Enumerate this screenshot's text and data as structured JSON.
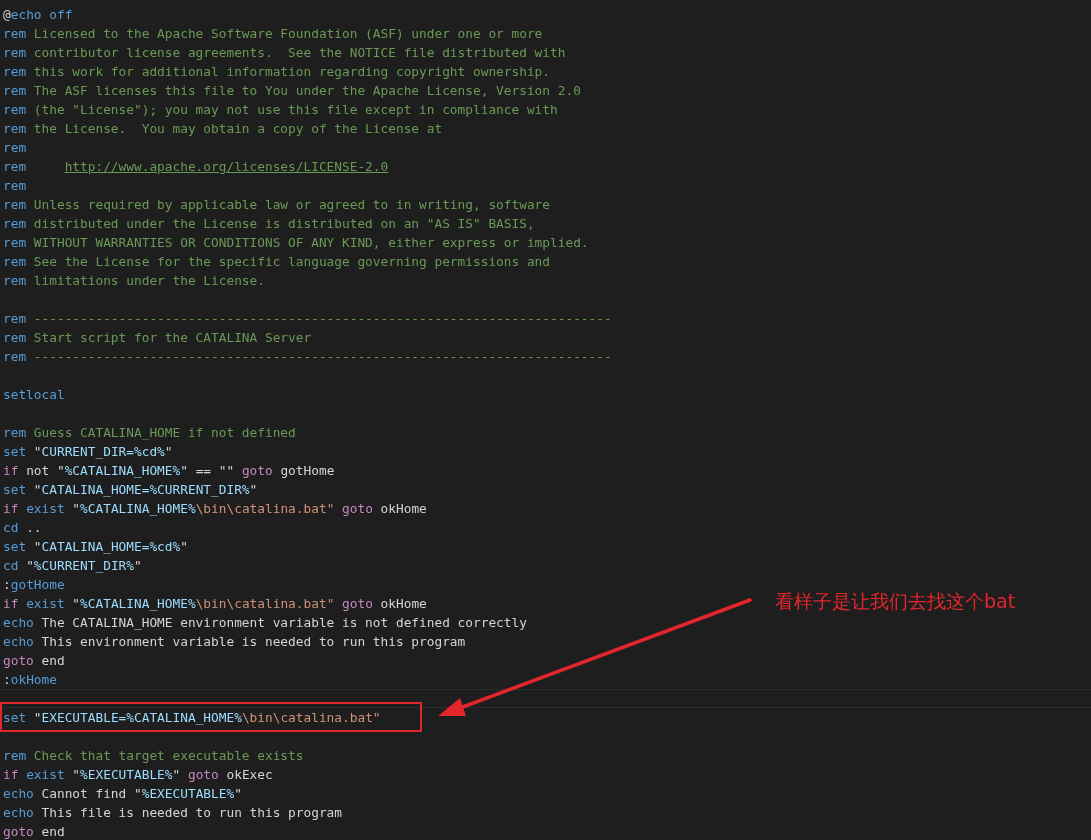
{
  "editor": {
    "lines": [
      {
        "current": false,
        "tokens": [
          {
            "kind": "plain",
            "text": "@"
          },
          {
            "kind": "kw",
            "text": "echo off"
          }
        ]
      },
      {
        "current": false,
        "tokens": [
          {
            "kind": "kw",
            "text": "rem"
          },
          {
            "kind": "comment",
            "text": " Licensed to the Apache Software Foundation (ASF) under one or more"
          }
        ]
      },
      {
        "current": false,
        "tokens": [
          {
            "kind": "kw",
            "text": "rem"
          },
          {
            "kind": "comment",
            "text": " contributor license agreements.  See the NOTICE file distributed with"
          }
        ]
      },
      {
        "current": false,
        "tokens": [
          {
            "kind": "kw",
            "text": "rem"
          },
          {
            "kind": "comment",
            "text": " this work for additional information regarding copyright ownership."
          }
        ]
      },
      {
        "current": false,
        "tokens": [
          {
            "kind": "kw",
            "text": "rem"
          },
          {
            "kind": "comment",
            "text": " The ASF licenses this file to You under the Apache License, Version 2.0"
          }
        ]
      },
      {
        "current": false,
        "tokens": [
          {
            "kind": "kw",
            "text": "rem"
          },
          {
            "kind": "comment",
            "text": " (the \"License\"); you may not use this file except in compliance with"
          }
        ]
      },
      {
        "current": false,
        "tokens": [
          {
            "kind": "kw",
            "text": "rem"
          },
          {
            "kind": "comment",
            "text": " the License.  You may obtain a copy of the License at"
          }
        ]
      },
      {
        "current": false,
        "tokens": [
          {
            "kind": "kw",
            "text": "rem"
          }
        ]
      },
      {
        "current": false,
        "tokens": [
          {
            "kind": "kw",
            "text": "rem     "
          },
          {
            "kind": "link",
            "text": "http://www.apache.org/licenses/LICENSE-2.0"
          }
        ]
      },
      {
        "current": false,
        "tokens": [
          {
            "kind": "kw",
            "text": "rem"
          }
        ]
      },
      {
        "current": false,
        "tokens": [
          {
            "kind": "kw",
            "text": "rem"
          },
          {
            "kind": "comment",
            "text": " Unless required by applicable law or agreed to in writing, software"
          }
        ]
      },
      {
        "current": false,
        "tokens": [
          {
            "kind": "kw",
            "text": "rem"
          },
          {
            "kind": "comment",
            "text": " distributed under the License is distributed on an \"AS IS\" BASIS,"
          }
        ]
      },
      {
        "current": false,
        "tokens": [
          {
            "kind": "kw",
            "text": "rem"
          },
          {
            "kind": "comment",
            "text": " WITHOUT WARRANTIES OR CONDITIONS OF ANY KIND, either express or implied."
          }
        ]
      },
      {
        "current": false,
        "tokens": [
          {
            "kind": "kw",
            "text": "rem"
          },
          {
            "kind": "comment",
            "text": " See the License for the specific language governing permissions and"
          }
        ]
      },
      {
        "current": false,
        "tokens": [
          {
            "kind": "kw",
            "text": "rem"
          },
          {
            "kind": "comment",
            "text": " limitations under the License."
          }
        ]
      },
      {
        "current": false
      },
      {
        "current": false,
        "tokens": [
          {
            "kind": "kw",
            "text": "rem"
          },
          {
            "kind": "comment",
            "text": " ---------------------------------------------------------------------------"
          }
        ]
      },
      {
        "current": false,
        "tokens": [
          {
            "kind": "kw",
            "text": "rem"
          },
          {
            "kind": "comment",
            "text": " Start script for the CATALINA Server"
          }
        ]
      },
      {
        "current": false,
        "tokens": [
          {
            "kind": "kw",
            "text": "rem"
          },
          {
            "kind": "comment",
            "text": " ---------------------------------------------------------------------------"
          }
        ]
      },
      {
        "current": false
      },
      {
        "current": false,
        "tokens": [
          {
            "kind": "kw",
            "text": "setlocal"
          }
        ]
      },
      {
        "current": false
      },
      {
        "current": false,
        "tokens": [
          {
            "kind": "kw",
            "text": "rem"
          },
          {
            "kind": "comment",
            "text": " Guess CATALINA_HOME if not defined"
          }
        ]
      },
      {
        "current": false,
        "tokens": [
          {
            "kind": "kw",
            "text": "set"
          },
          {
            "kind": "plain",
            "text": " \""
          },
          {
            "kind": "var",
            "text": "CURRENT_DIR=%cd%"
          },
          {
            "kind": "plain",
            "text": "\""
          }
        ]
      },
      {
        "current": false,
        "tokens": [
          {
            "kind": "ctrl",
            "text": "if"
          },
          {
            "kind": "plain",
            "text": " not \""
          },
          {
            "kind": "var",
            "text": "%CATALINA_HOME%"
          },
          {
            "kind": "plain",
            "text": "\" == \"\" "
          },
          {
            "kind": "ctrl",
            "text": "goto"
          },
          {
            "kind": "plain",
            "text": " gotHome"
          }
        ]
      },
      {
        "current": false,
        "tokens": [
          {
            "kind": "kw",
            "text": "set"
          },
          {
            "kind": "plain",
            "text": " \""
          },
          {
            "kind": "var",
            "text": "CATALINA_HOME=%CURRENT_DIR%"
          },
          {
            "kind": "plain",
            "text": "\""
          }
        ]
      },
      {
        "current": false,
        "tokens": [
          {
            "kind": "ctrl",
            "text": "if"
          },
          {
            "kind": "kw",
            "text": " exist"
          },
          {
            "kind": "plain",
            "text": " \""
          },
          {
            "kind": "var",
            "text": "%CATALINA_HOME%"
          },
          {
            "kind": "str",
            "text": "\\bin\\catalina.bat\""
          },
          {
            "kind": "ctrl",
            "text": " goto"
          },
          {
            "kind": "plain",
            "text": " okHome"
          }
        ]
      },
      {
        "current": false,
        "tokens": [
          {
            "kind": "kw",
            "text": "cd"
          },
          {
            "kind": "plain",
            "text": " .."
          }
        ]
      },
      {
        "current": false,
        "tokens": [
          {
            "kind": "kw",
            "text": "set"
          },
          {
            "kind": "plain",
            "text": " \""
          },
          {
            "kind": "var",
            "text": "CATALINA_HOME=%cd%"
          },
          {
            "kind": "plain",
            "text": "\""
          }
        ]
      },
      {
        "current": false,
        "tokens": [
          {
            "kind": "kw",
            "text": "cd"
          },
          {
            "kind": "plain",
            "text": " \""
          },
          {
            "kind": "var",
            "text": "%CURRENT_DIR%"
          },
          {
            "kind": "plain",
            "text": "\""
          }
        ]
      },
      {
        "current": false,
        "tokens": [
          {
            "kind": "plain",
            "text": ":"
          },
          {
            "kind": "kw",
            "text": "gotHome"
          }
        ]
      },
      {
        "current": false,
        "tokens": [
          {
            "kind": "ctrl",
            "text": "if"
          },
          {
            "kind": "kw",
            "text": " exist"
          },
          {
            "kind": "plain",
            "text": " \""
          },
          {
            "kind": "var",
            "text": "%CATALINA_HOME%"
          },
          {
            "kind": "str",
            "text": "\\bin\\catalina.bat\""
          },
          {
            "kind": "ctrl",
            "text": " goto"
          },
          {
            "kind": "plain",
            "text": " okHome"
          }
        ]
      },
      {
        "current": false,
        "tokens": [
          {
            "kind": "kw",
            "text": "echo"
          },
          {
            "kind": "plain",
            "text": " The CATALINA_HOME environment variable is not defined correctly"
          }
        ]
      },
      {
        "current": false,
        "tokens": [
          {
            "kind": "kw",
            "text": "echo"
          },
          {
            "kind": "plain",
            "text": " This environment variable is needed to run this program"
          }
        ]
      },
      {
        "current": false,
        "tokens": [
          {
            "kind": "ctrl",
            "text": "goto"
          },
          {
            "kind": "plain",
            "text": " end"
          }
        ]
      },
      {
        "current": false,
        "tokens": [
          {
            "kind": "plain",
            "text": ":"
          },
          {
            "kind": "kw",
            "text": "okHome"
          }
        ]
      },
      {
        "current": true
      },
      {
        "current": false,
        "framed": true,
        "tokens": [
          {
            "kind": "kw",
            "text": "set"
          },
          {
            "kind": "plain",
            "text": " \""
          },
          {
            "kind": "var",
            "text": "EXECUTABLE=%CATALINA_HOME%"
          },
          {
            "kind": "str",
            "text": "\\bin\\catalina.bat\""
          }
        ]
      },
      {
        "current": false
      },
      {
        "current": false,
        "tokens": [
          {
            "kind": "kw",
            "text": "rem"
          },
          {
            "kind": "comment",
            "text": " Check that target executable exists"
          }
        ]
      },
      {
        "current": false,
        "tokens": [
          {
            "kind": "ctrl",
            "text": "if"
          },
          {
            "kind": "kw",
            "text": " exist"
          },
          {
            "kind": "plain",
            "text": " \""
          },
          {
            "kind": "var",
            "text": "%EXECUTABLE%"
          },
          {
            "kind": "plain",
            "text": "\" "
          },
          {
            "kind": "ctrl",
            "text": "goto"
          },
          {
            "kind": "plain",
            "text": " okExec"
          }
        ]
      },
      {
        "current": false,
        "tokens": [
          {
            "kind": "kw",
            "text": "echo"
          },
          {
            "kind": "plain",
            "text": " Cannot find \""
          },
          {
            "kind": "var",
            "text": "%EXECUTABLE%"
          },
          {
            "kind": "plain",
            "text": "\""
          }
        ]
      },
      {
        "current": false,
        "tokens": [
          {
            "kind": "kw",
            "text": "echo"
          },
          {
            "kind": "plain",
            "text": " This file is needed to run this program"
          }
        ]
      },
      {
        "current": false,
        "tokens": [
          {
            "kind": "ctrl",
            "text": "goto"
          },
          {
            "kind": "plain",
            "text": " end"
          }
        ]
      }
    ]
  },
  "annotation": {
    "note": "看样子是让我们去找这个bat"
  }
}
